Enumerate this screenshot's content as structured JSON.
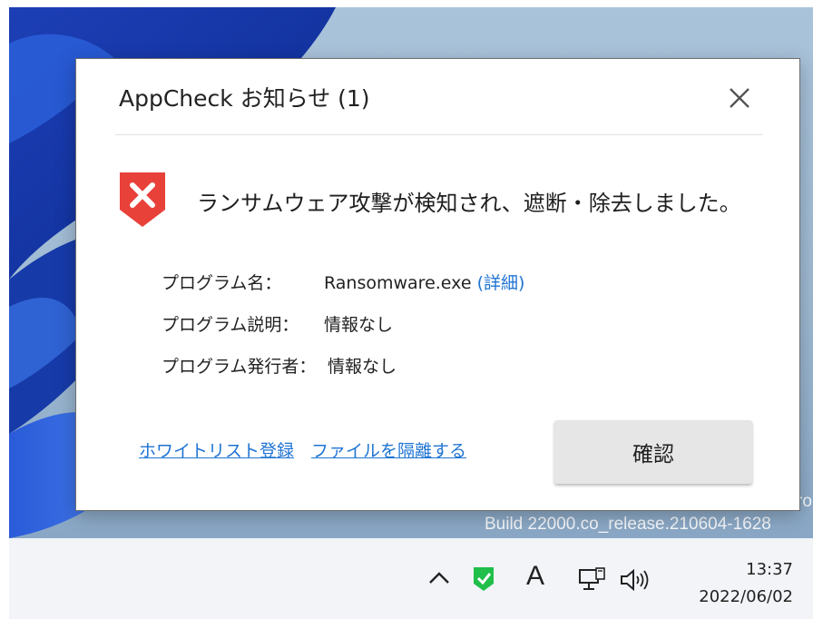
{
  "desktop": {
    "watermark_line1": "ro",
    "watermark_line2": "Build 22000.co_release.210604-1628"
  },
  "dialog": {
    "title": "AppCheck お知らせ (1)",
    "message": "ランサムウェア攻撃が検知され、遮断・除去しました。",
    "icon": "red-shield-x-icon",
    "info": [
      {
        "label": "プログラム名：",
        "value": "Ransomware.exe",
        "link": "(詳細)"
      },
      {
        "label": "プログラム説明：",
        "value": "情報なし"
      },
      {
        "label": "プログラム発行者：",
        "value": "情報なし"
      }
    ],
    "links": {
      "whitelist": "ホワイトリスト登録",
      "quarantine": "ファイルを隔離する"
    },
    "confirm_label": "確認",
    "accent_color": "#e8413a",
    "link_color": "#1f74d2"
  },
  "taskbar": {
    "ime_indicator": "A",
    "time": "13:37",
    "date": "2022/06/02",
    "tray_icons": [
      "chevron-up-icon",
      "appcheck-shield-icon",
      "ime-icon",
      "network-icon",
      "volume-icon"
    ]
  }
}
